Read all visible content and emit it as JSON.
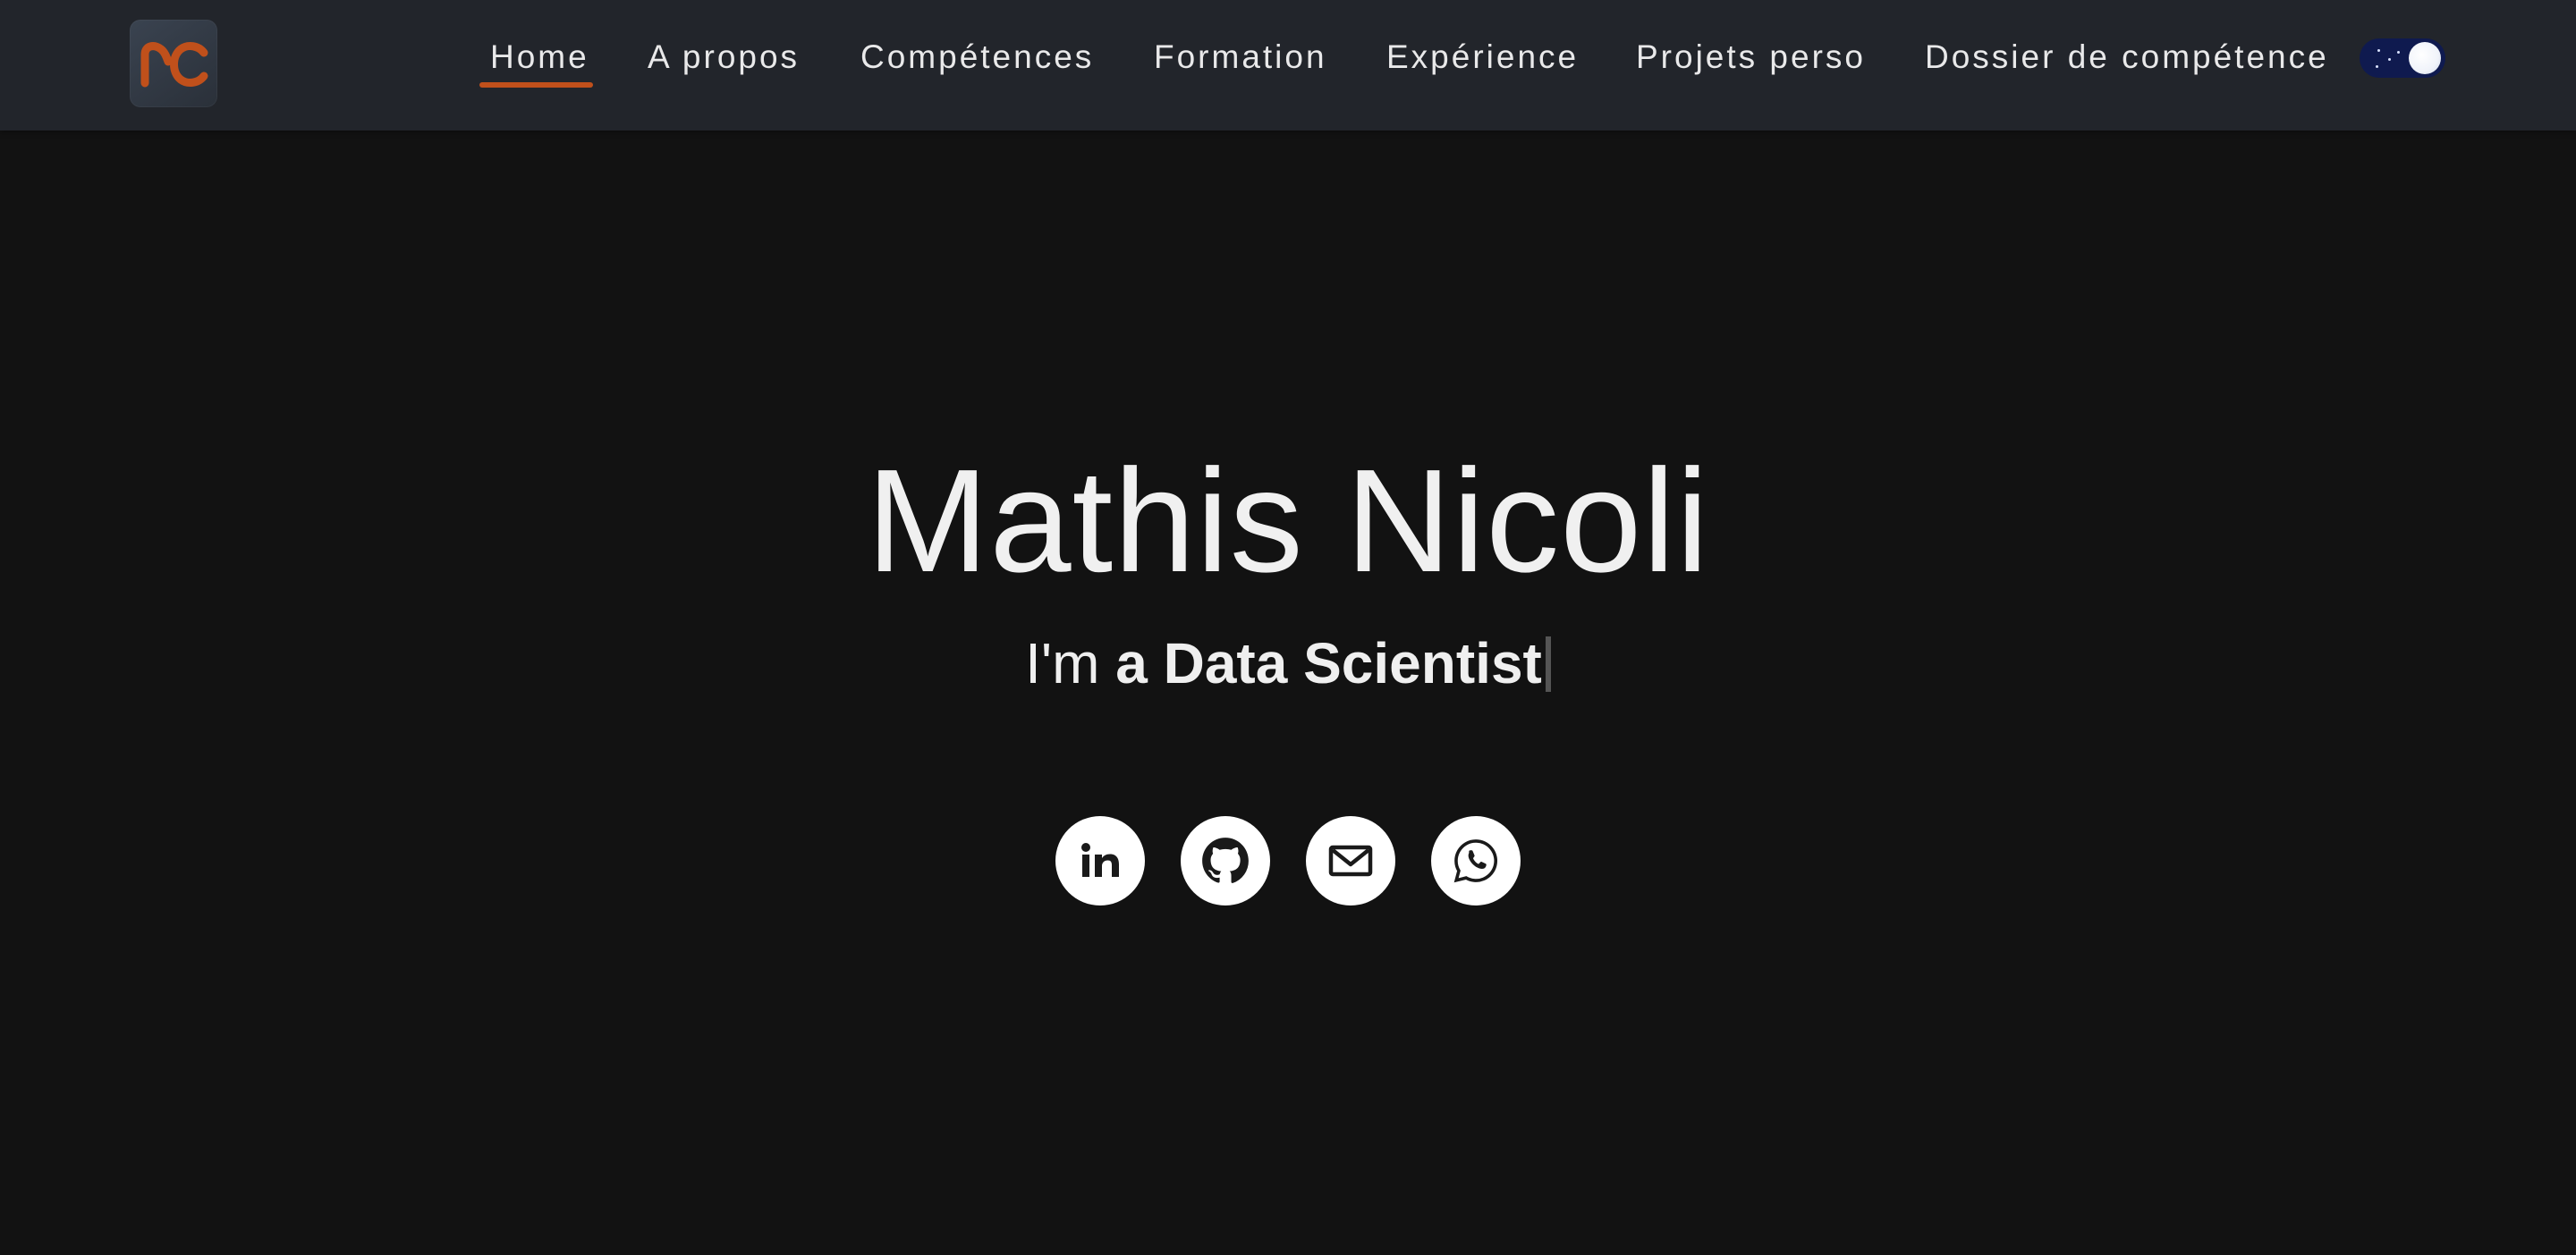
{
  "colors": {
    "page_background": "#121212",
    "navbar_background": "#22252b",
    "accent": "#c0501b",
    "text": "#f0f0f0",
    "toggle_track": "#0f1a4f"
  },
  "navbar": {
    "logo": {
      "icon": "rc-logo-icon"
    },
    "links": [
      {
        "label": "Home",
        "active": true
      },
      {
        "label": "A propos",
        "active": false
      },
      {
        "label": "Compétences",
        "active": false
      },
      {
        "label": "Formation",
        "active": false
      },
      {
        "label": "Expérience",
        "active": false
      },
      {
        "label": "Projets perso",
        "active": false
      },
      {
        "label": "Dossier de compétence",
        "active": false
      }
    ],
    "theme_toggle": {
      "icon": "moon-toggle-icon",
      "mode": "dark"
    }
  },
  "hero": {
    "name": "Mathis Nicoli",
    "intro_prefix": "I'm ",
    "role": "a Data Scientist"
  },
  "social": [
    {
      "icon": "linkedin-icon"
    },
    {
      "icon": "github-icon"
    },
    {
      "icon": "mail-icon"
    },
    {
      "icon": "whatsapp-icon"
    }
  ]
}
